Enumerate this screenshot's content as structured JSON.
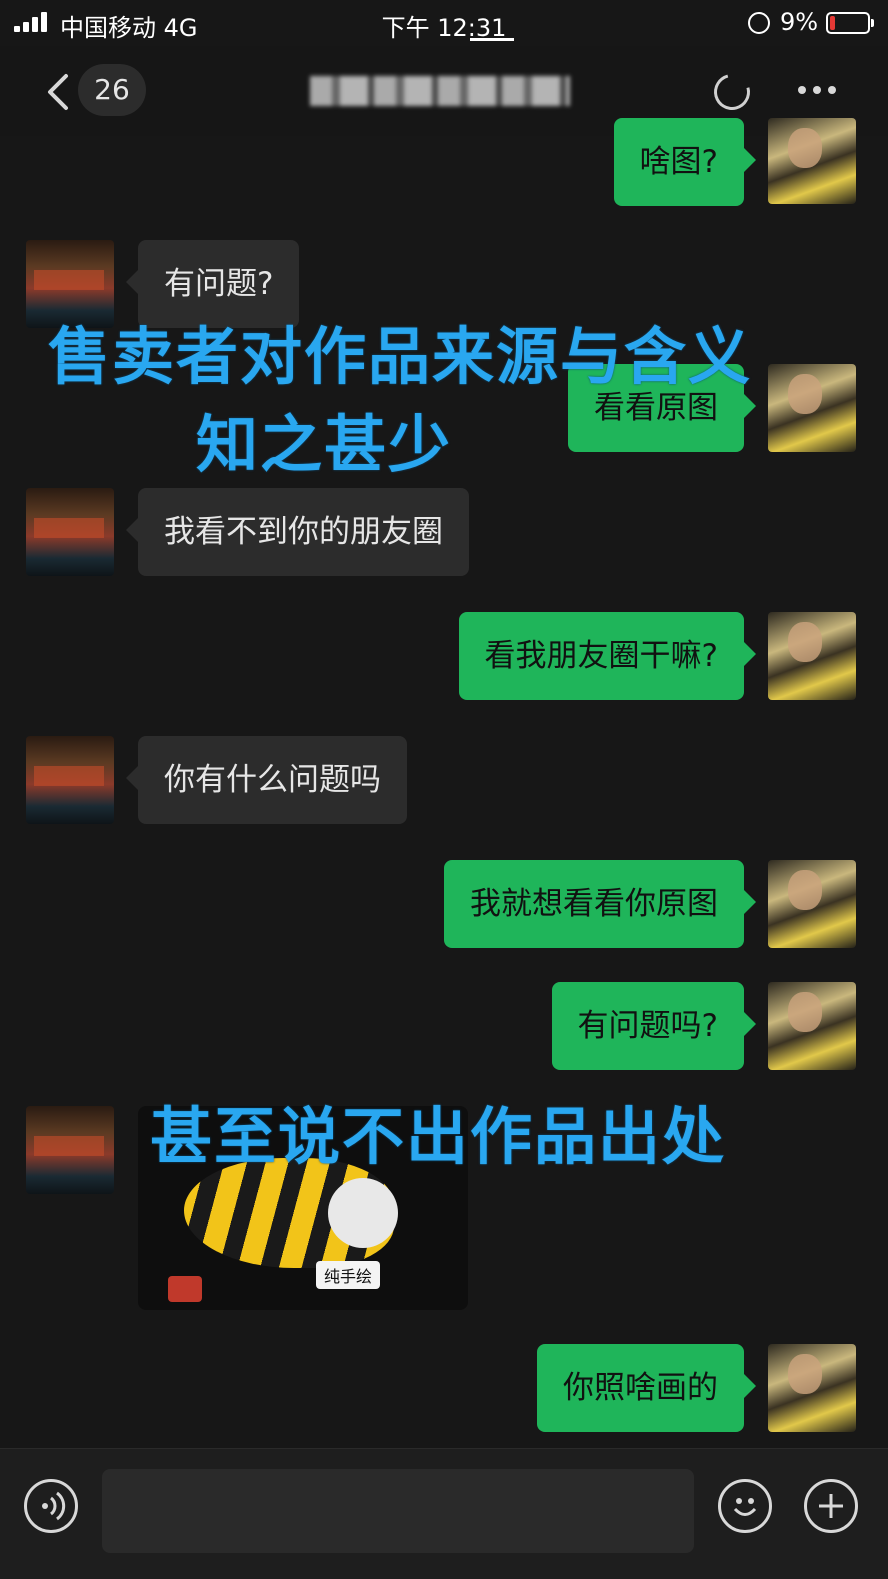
{
  "status": {
    "carrier": "中国移动  4G",
    "time": "下午 12:31",
    "battery": "9%"
  },
  "nav": {
    "unread_count": "26"
  },
  "messages": [
    {
      "side": "out",
      "text": "啥图?"
    },
    {
      "side": "in",
      "text": "有问题?"
    },
    {
      "side": "out",
      "text": "看看原图"
    },
    {
      "side": "in",
      "text": "我看不到你的朋友圈"
    },
    {
      "side": "out",
      "text": "看我朋友圈干嘛?"
    },
    {
      "side": "in",
      "text": "你有什么问题吗"
    },
    {
      "side": "out",
      "text": "我就想看看你原图"
    },
    {
      "side": "out",
      "text": "有问题吗?"
    },
    {
      "side": "in",
      "type": "image",
      "caption": "纯手绘"
    },
    {
      "side": "out",
      "text": "你照啥画的"
    }
  ],
  "overlays": {
    "line1": "售卖者对作品来源与含义",
    "line2": "知之甚少",
    "line3": "甚至说不出作品出处"
  },
  "colors": {
    "accent_out": "#1fb55a",
    "bubble_in": "#2c2c2c",
    "overlay": "#29a7f0"
  },
  "icons": [
    "back-icon",
    "refresh-icon",
    "more-icon",
    "voice-icon",
    "emoji-icon",
    "plus-icon"
  ]
}
